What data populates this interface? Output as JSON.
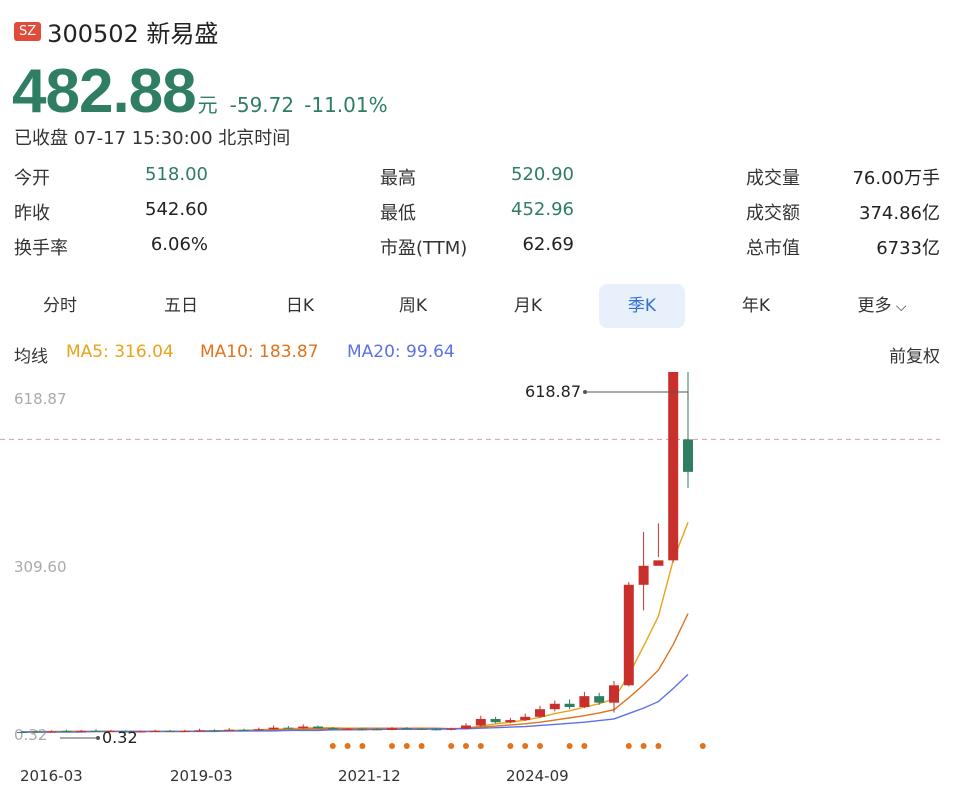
{
  "stock": {
    "market": "SZ",
    "code_name": "300502 新易盛",
    "price": "482.88",
    "unit": "元",
    "change": "-59.72",
    "change_pct": "-11.01%",
    "status": "已收盘 07-17 15:30:00 北京时间"
  },
  "stats": [
    {
      "label": "今开",
      "value": "518.00",
      "color": "#2f7d62"
    },
    {
      "label": "最高",
      "value": "520.90",
      "color": "#2f7d62"
    },
    {
      "label": "成交量",
      "value": "76.00万手",
      "color": "#222222"
    },
    {
      "label": "昨收",
      "value": "542.60",
      "color": "#222222"
    },
    {
      "label": "最低",
      "value": "452.96",
      "color": "#2f7d62"
    },
    {
      "label": "成交额",
      "value": "374.86亿",
      "color": "#222222"
    },
    {
      "label": "换手率",
      "value": "6.06%",
      "color": "#222222"
    },
    {
      "label": "市盈(TTM)",
      "value": "62.69",
      "color": "#222222"
    },
    {
      "label": "总市值",
      "value": "6733亿",
      "color": "#222222"
    }
  ],
  "tabs": [
    "分时",
    "五日",
    "日K",
    "周K",
    "月K",
    "季K",
    "年K",
    "更多"
  ],
  "active_tab": "季K",
  "ma": {
    "label": "均线",
    "ma5": "MA5: 316.04",
    "ma10": "MA10: 183.87",
    "ma20": "MA20: 99.64",
    "adjust": "前复权"
  },
  "colors": {
    "up": "#c9302c",
    "down": "#2f7d62",
    "ma5": "#e8a317",
    "ma10": "#e0731c",
    "ma20": "#5b72e6",
    "accent": "#2f6fd6"
  },
  "chart_data": {
    "type": "candlestick",
    "y_ticks": [
      "618.87",
      "309.60",
      "0.32"
    ],
    "ylim": [
      0.32,
      618.87
    ],
    "x_labels": [
      "2016-03",
      "2019-03",
      "2021-12",
      "2024-09"
    ],
    "max_label": "618.87",
    "min_label": "0.32",
    "prev_close_line": 542.6,
    "candles": [
      [
        4,
        3,
        6,
        2
      ],
      [
        5,
        4,
        7,
        3
      ],
      [
        4,
        5,
        7,
        3
      ],
      [
        6,
        5,
        8,
        4
      ],
      [
        5,
        6,
        8,
        4
      ],
      [
        6,
        5,
        9,
        4
      ],
      [
        5,
        6,
        8,
        4
      ],
      [
        5,
        4,
        7,
        3
      ],
      [
        4,
        5,
        7,
        3
      ],
      [
        5,
        6,
        8,
        4
      ],
      [
        6,
        5,
        8,
        4
      ],
      [
        5,
        6,
        8,
        4
      ],
      [
        6,
        7,
        10,
        5
      ],
      [
        7,
        6,
        9,
        5
      ],
      [
        6,
        8,
        11,
        5
      ],
      [
        8,
        7,
        10,
        6
      ],
      [
        7,
        9,
        12,
        6
      ],
      [
        9,
        12,
        16,
        8
      ],
      [
        12,
        11,
        15,
        10
      ],
      [
        11,
        14,
        18,
        10
      ],
      [
        14,
        11,
        16,
        10
      ],
      [
        11,
        9,
        13,
        8
      ],
      [
        9,
        10,
        12,
        8
      ],
      [
        10,
        9,
        12,
        8
      ],
      [
        9,
        8,
        11,
        7
      ],
      [
        8,
        11,
        13,
        7
      ],
      [
        11,
        10,
        13,
        9
      ],
      [
        10,
        9,
        12,
        8
      ],
      [
        9,
        8,
        11,
        7
      ],
      [
        8,
        10,
        12,
        7
      ],
      [
        10,
        16,
        20,
        9
      ],
      [
        16,
        28,
        34,
        14
      ],
      [
        28,
        22,
        32,
        20
      ],
      [
        22,
        26,
        30,
        20
      ],
      [
        26,
        32,
        38,
        24
      ],
      [
        32,
        46,
        52,
        30
      ],
      [
        46,
        56,
        62,
        42
      ],
      [
        56,
        50,
        64,
        46
      ],
      [
        50,
        70,
        78,
        48
      ],
      [
        70,
        58,
        76,
        54
      ],
      [
        58,
        90,
        98,
        40
      ],
      [
        90,
        275,
        280,
        88
      ],
      [
        275,
        310,
        372,
        228
      ],
      [
        310,
        320,
        388,
        326
      ],
      [
        320,
        700,
        698,
        316
      ],
      [
        542.6,
        482.88,
        700,
        452.96
      ]
    ],
    "ma5": [
      4,
      4,
      5,
      5,
      5,
      5,
      5,
      5,
      5,
      5,
      5,
      5,
      6,
      6,
      7,
      7,
      8,
      9,
      10,
      11,
      12,
      12,
      11,
      11,
      10,
      10,
      10,
      10,
      9,
      9,
      11,
      15,
      19,
      22,
      26,
      31,
      38,
      43,
      50,
      56,
      65,
      109,
      162,
      217,
      320,
      390
    ],
    "ma10": [
      4,
      4,
      4,
      5,
      5,
      5,
      5,
      5,
      5,
      5,
      5,
      5,
      6,
      6,
      6,
      6,
      7,
      8,
      8,
      9,
      10,
      10,
      10,
      11,
      11,
      11,
      11,
      11,
      11,
      10,
      11,
      13,
      15,
      17,
      19,
      22,
      26,
      30,
      34,
      39,
      45,
      67,
      91,
      118,
      165,
      222
    ],
    "ma20": [
      4,
      4,
      4,
      4,
      4,
      5,
      5,
      5,
      5,
      5,
      5,
      5,
      5,
      5,
      6,
      6,
      6,
      6,
      7,
      7,
      7,
      8,
      8,
      8,
      9,
      9,
      9,
      9,
      10,
      10,
      10,
      11,
      12,
      13,
      14,
      16,
      18,
      20,
      22,
      25,
      28,
      38,
      48,
      60,
      84,
      110
    ],
    "signal_dots": [
      21,
      22,
      23,
      25,
      26,
      27,
      29,
      30,
      31,
      33,
      34,
      35,
      37,
      38,
      41,
      42,
      43,
      46
    ]
  }
}
